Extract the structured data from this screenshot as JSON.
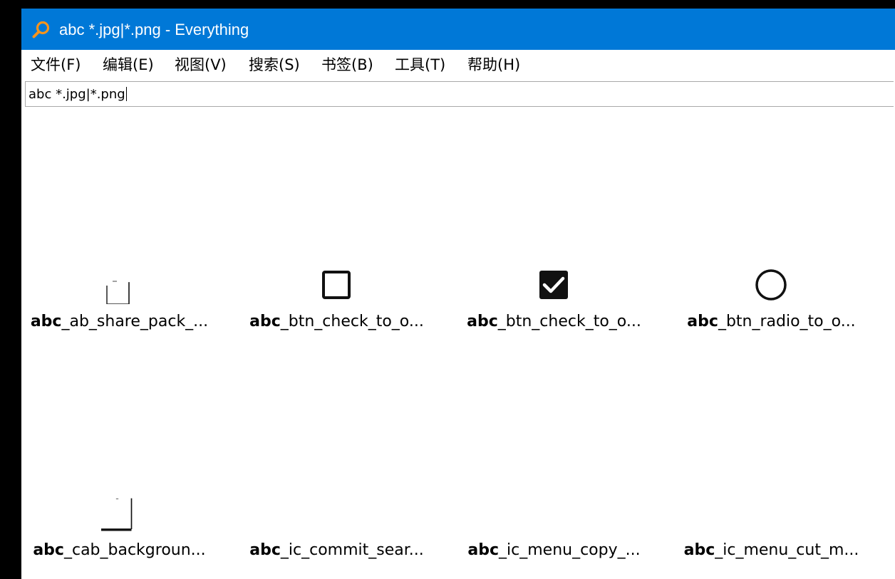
{
  "window": {
    "title": "abc *.jpg|*.png - Everything",
    "accent_color": "#0078d7",
    "app_icon": "search-magnifier-icon"
  },
  "menu": {
    "items": [
      {
        "label": "文件(F)"
      },
      {
        "label": "编辑(E)"
      },
      {
        "label": "视图(V)"
      },
      {
        "label": "搜索(S)"
      },
      {
        "label": "书签(B)"
      },
      {
        "label": "工具(T)"
      },
      {
        "label": "帮助(H)"
      }
    ]
  },
  "search": {
    "value": "abc *.jpg|*.png"
  },
  "results": {
    "items": [
      {
        "match": "abc",
        "rest": "_ab_share_pack_...",
        "icon": "share-pack-thumbnail-icon"
      },
      {
        "match": "abc",
        "rest": "_btn_check_to_o...",
        "icon": "checkbox-unchecked-icon"
      },
      {
        "match": "abc",
        "rest": "_btn_check_to_o...",
        "icon": "checkbox-checked-icon"
      },
      {
        "match": "abc",
        "rest": "_btn_radio_to_o...",
        "icon": "radio-button-icon"
      },
      {
        "match": "abc",
        "rest": "_cab_backgroun...",
        "icon": "cab-background-thumbnail-icon"
      },
      {
        "match": "abc",
        "rest": "_ic_commit_sear...",
        "icon": "blank-thumbnail-icon"
      },
      {
        "match": "abc",
        "rest": "_ic_menu_copy_...",
        "icon": "blank-thumbnail-icon"
      },
      {
        "match": "abc",
        "rest": "_ic_menu_cut_m...",
        "icon": "blank-thumbnail-icon"
      }
    ]
  }
}
